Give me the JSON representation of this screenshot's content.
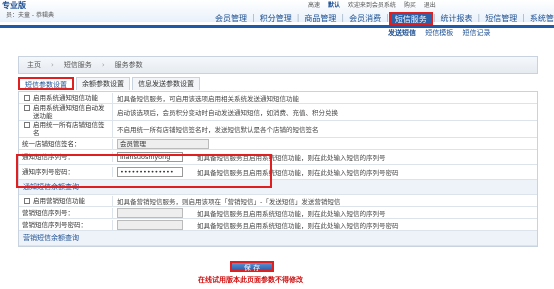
{
  "header": {
    "logo": "专业版",
    "user_line": "员：夫童 - 恭辑典",
    "top_links": [
      "高速",
      "默认",
      "欢迎来到会员系统",
      "购买",
      "退出"
    ],
    "main_nav": [
      "会员管理",
      "积分管理",
      "商品管理",
      "会员消费",
      "短信服务",
      "统计报表",
      "短信管理",
      "系统管理"
    ],
    "active_nav": "短信服务"
  },
  "sub_nav": [
    "发送短信",
    "短信模板",
    "短信记录"
  ],
  "breadcrumb": [
    "主页",
    "短信服务",
    "服务参数"
  ],
  "tabs": [
    "短信参数设置",
    "余额参数设置",
    "信息发送参数设置"
  ],
  "form": {
    "rows": [
      {
        "label": "启用系统通知短信功能",
        "text": "如具备短信服务，可启用该选项启用相关系统发送通知短信功能",
        "checkbox": true
      },
      {
        "label": "启用系统通知短信自动发送功能",
        "text": "启动该选项后，会员积分变动时自动发送通知短信，如消费、充值、积分兑换",
        "checkbox": true
      },
      {
        "label": "启用统一所有店铺短信签名",
        "text": "不启用统一所有店铺短信签名时，发送短信默认是各个店铺的短信签名",
        "checkbox": true
      },
      {
        "label": "统一店铺短信签名：",
        "input": "会员管理",
        "checkbox": false
      }
    ],
    "account_label": "通知短信序列号：",
    "account_value": "lliansuoshiyong",
    "account_hint": "如具备短信服务且启用系统短信功能，则在此处输入短信的序列号",
    "password_label": "通知序列号密码：",
    "password_value": "••••••••••••••",
    "password_hint": "如具备短信服务且启用系统短信功能，则在此处输入短信的序列号密码",
    "section2_title": "通知短信余额查询",
    "marketing_rows": [
      {
        "label": "启用营销短信功能",
        "text": "如具备营销短信服务，则启用该项在「营销短信」-「发送短信」发送营销短信",
        "checkbox": true
      },
      {
        "label": "营销短信序列号：",
        "hint": "如具备短信服务且启用系统短信功能，则在此处输入短信的序列号"
      },
      {
        "label": "营销短信序列号密码：",
        "hint": "如具备短信服务且启用系统短信功能，则在此处输入短信的序列号密码"
      }
    ],
    "section3_title": "营销短信余额查询"
  },
  "save_label": "保 存",
  "note": "在线试用版本此页面参数不得修改",
  "colors": {
    "accent": "#1d5aa8",
    "highlight": "#e02020"
  }
}
